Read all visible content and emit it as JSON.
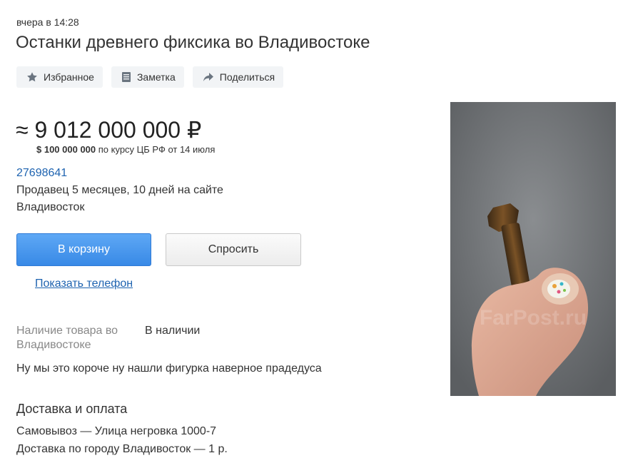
{
  "listing": {
    "date": "вчера в 14:28",
    "title": "Останки древнего фиксика во Владивостоке"
  },
  "actions": [
    {
      "label": "Избранное",
      "icon": "star-icon"
    },
    {
      "label": "Заметка",
      "icon": "note-icon"
    },
    {
      "label": "Поделиться",
      "icon": "share-icon"
    }
  ],
  "price": {
    "main": "≈ 9 012 000 000 ₽",
    "usd_amount": "$ 100 000 000",
    "usd_note": " по курсу ЦБ РФ от 14 июля"
  },
  "seller": {
    "id": "27698641",
    "age": "Продавец 5 месяцев, 10 дней на сайте",
    "city": "Владивосток"
  },
  "buttons": {
    "cart": "В корзину",
    "ask": "Спросить",
    "show_phone": "Показать телефон"
  },
  "availability": {
    "label": "Наличие товара во Владивостоке",
    "value": "В наличии"
  },
  "description": "Ну мы это короче ну нашли фигурка наверное прадедуса",
  "delivery": {
    "heading": "Доставка и оплата",
    "lines": [
      "Самовывоз — Улица негровка 1000-7",
      "Доставка по городу Владивосток — 1 р."
    ]
  },
  "photo": {
    "watermark": "FarPost.ru"
  },
  "colors": {
    "link": "#1e63b0",
    "cart_button": "#3f8fe8",
    "action_bg": "#f2f4f6"
  }
}
